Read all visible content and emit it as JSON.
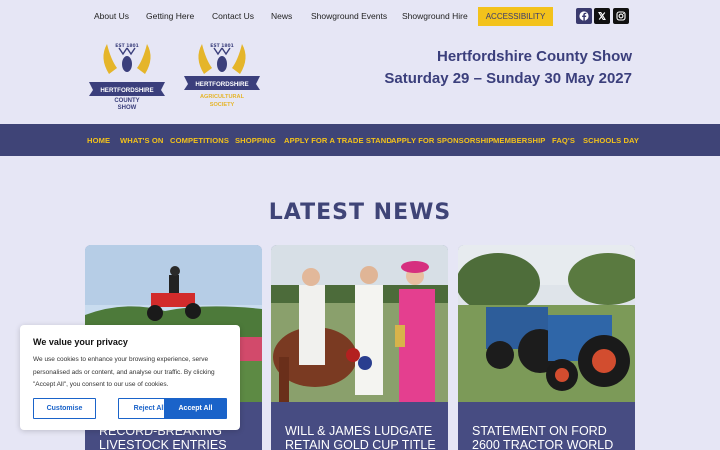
{
  "topnav": {
    "items": [
      "About Us",
      "Getting Here",
      "Contact Us",
      "News",
      "Showground Events",
      "Showground Hire"
    ],
    "accessibility": "ACCESSIBILITY",
    "social": [
      "facebook-icon",
      "x-icon",
      "instagram-icon"
    ]
  },
  "logos": {
    "county_show": {
      "est": "EST 1801",
      "line1": "HERTFORDSHIRE",
      "line2": "COUNTY",
      "line3": "SHOW"
    },
    "agricultural_society": {
      "est": "EST 1801",
      "line1": "HERTFORDSHIRE",
      "line2": "AGRICULTURAL",
      "line3": "SOCIETY"
    }
  },
  "header": {
    "title": "Hertfordshire County Show",
    "dates": "Saturday 29 – Sunday 30 May 2027"
  },
  "mainnav": {
    "items": [
      "HOME",
      "WHAT'S ON",
      "COMPETITIONS",
      "SHOPPING",
      "APPLY FOR A TRADE STAND",
      "APPLY FOR SPONSORSHIP",
      "MEMBERSHIP",
      "FAQ'S",
      "SCHOOLS DAY"
    ]
  },
  "news": {
    "heading": "LATEST NEWS",
    "cards": [
      {
        "title": "RECORD-BREAKING LIVESTOCK ENTRIES AND"
      },
      {
        "title": "WILL & JAMES LUDGATE RETAIN GOLD CUP TITLE"
      },
      {
        "title": "STATEMENT ON FORD 2600 TRACTOR WORLD"
      }
    ]
  },
  "cookie": {
    "title": "We value your privacy",
    "body": "We use cookies to enhance your browsing experience, serve personalised ads or content, and analyse our traffic. By clicking \"Accept All\", you consent to our use of cookies.",
    "customise": "Customise",
    "reject": "Reject All",
    "accept": "Accept All"
  },
  "colors": {
    "nav_bg": "#3f4477",
    "accent_yellow": "#f3c21b",
    "page_bg": "#e6e6f5",
    "button_blue": "#1a63c9"
  }
}
